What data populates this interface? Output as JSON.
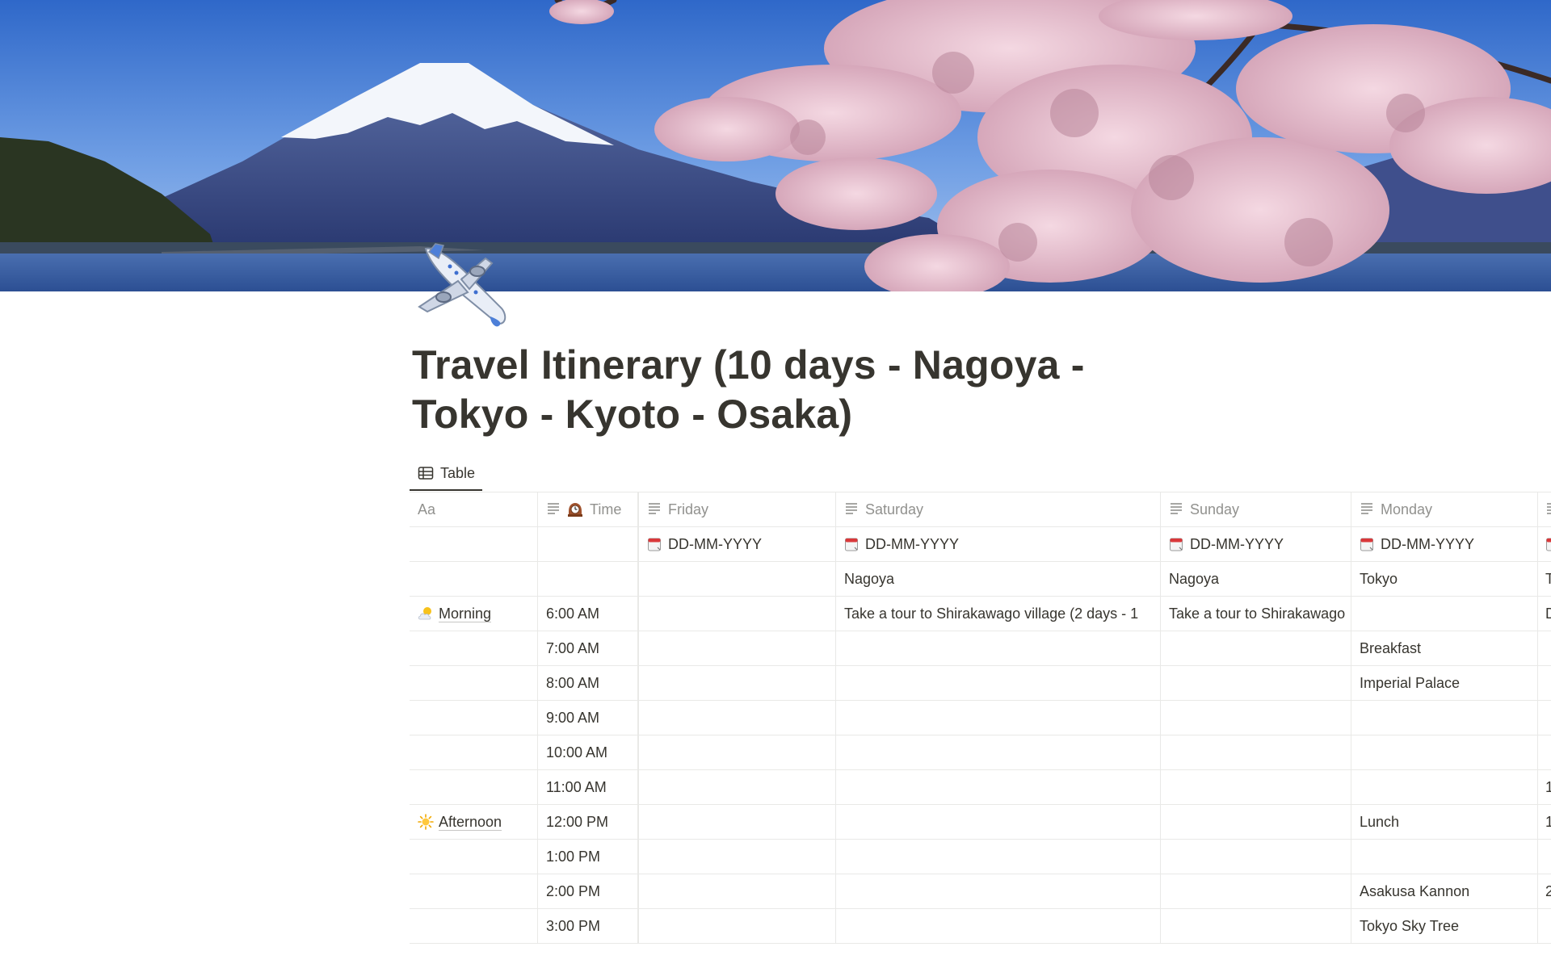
{
  "page": {
    "title": "Travel Itinerary (10 days - Nagoya - Tokyo - Kyoto - Osaka)",
    "icon": "airplane-icon"
  },
  "view_tabs": [
    {
      "label": "Table",
      "icon": "table-icon"
    }
  ],
  "table": {
    "headers": [
      {
        "label": "Aa",
        "icon": ""
      },
      {
        "label": "Time",
        "icon": "text-property-icon"
      },
      {
        "label": "Friday",
        "icon": "text-property-icon"
      },
      {
        "label": "Saturday",
        "icon": "text-property-icon"
      },
      {
        "label": "Sunday",
        "icon": "text-property-icon"
      },
      {
        "label": "Monday",
        "icon": "text-property-icon"
      }
    ],
    "time_header_emoji": "mantelpiece-clock-icon",
    "dates": [
      "DD-MM-YYYY",
      "DD-MM-YYYY",
      "DD-MM-YYYY",
      "DD-MM-YYYY"
    ],
    "cities": [
      "",
      "Nagoya",
      "Nagoya",
      "Tokyo",
      "T"
    ],
    "periods": [
      {
        "label": "Morning",
        "icon": "sun-behind-cloud-icon"
      },
      {
        "label": "Afternoon",
        "icon": "sun-icon"
      }
    ],
    "rows": [
      {
        "time": "6:00 AM",
        "cells": [
          "",
          "Take a tour to Shirakawago village (2 days - 1",
          "Take a tour to Shirakawago",
          "",
          "D"
        ]
      },
      {
        "time": "7:00 AM",
        "cells": [
          "",
          "",
          "",
          "Breakfast",
          ""
        ]
      },
      {
        "time": "8:00 AM",
        "cells": [
          "",
          "",
          "",
          "Imperial Palace",
          ""
        ]
      },
      {
        "time": "9:00 AM",
        "cells": [
          "",
          "",
          "",
          "",
          ""
        ]
      },
      {
        "time": "10:00 AM",
        "cells": [
          "",
          "",
          "",
          "",
          ""
        ]
      },
      {
        "time": "11:00 AM",
        "cells": [
          "",
          "",
          "",
          "",
          "1"
        ]
      },
      {
        "time": "12:00 PM",
        "cells": [
          "",
          "",
          "",
          "Lunch",
          "1"
        ]
      },
      {
        "time": "1:00 PM",
        "cells": [
          "",
          "",
          "",
          "",
          ""
        ]
      },
      {
        "time": "2:00 PM",
        "cells": [
          "",
          "",
          "",
          "Asakusa Kannon",
          "2"
        ]
      },
      {
        "time": "3:00 PM",
        "cells": [
          "",
          "",
          "",
          "Tokyo Sky Tree",
          ""
        ]
      }
    ]
  }
}
